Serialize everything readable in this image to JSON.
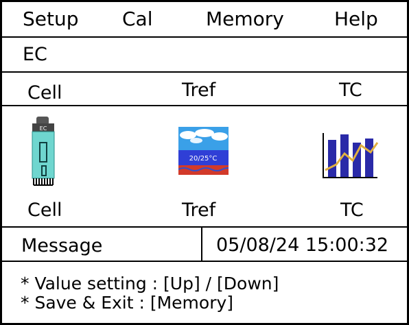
{
  "menu": {
    "setup": "Setup",
    "cal": "Cal",
    "memory": "Memory",
    "help": "Help"
  },
  "mode": "EC",
  "header_row": {
    "cell": "Cell",
    "tref": "Tref",
    "tc": "TC"
  },
  "icons": {
    "cell": {
      "name": "conductivity-cell-icon",
      "badge": "EC"
    },
    "tref": {
      "name": "reference-temperature-icon",
      "badge": "20/25°C"
    },
    "tc": {
      "name": "temperature-coefficient-chart-icon"
    }
  },
  "icon_labels": {
    "cell": "Cell",
    "tref": "Tref",
    "tc": "TC"
  },
  "status": {
    "message_label": "Message",
    "datetime": "05/08/24 15:00:32"
  },
  "hints": [
    "* Value setting : [Up] / [Down]",
    "* Save & Exit : [Memory]"
  ],
  "colors": {
    "cell_probe": "#6fd6cf",
    "tref_sky": "#3aa0e8",
    "tref_band": "#2f3fd6",
    "tref_ground": "#d23a2a",
    "tc_bars": "#2a2aa8",
    "tc_line": "#e0b040"
  }
}
